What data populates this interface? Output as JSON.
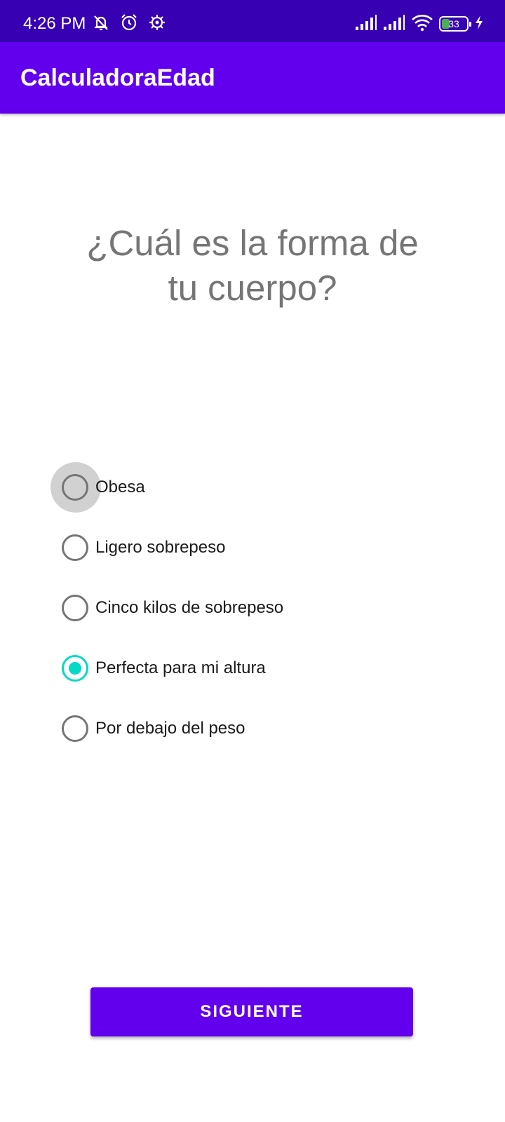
{
  "status_bar": {
    "time": "4:26 PM",
    "left_icons": [
      "muted-bell-icon",
      "alarm-icon",
      "settings-gear-icon"
    ],
    "right_icons": [
      "signal-bars-icon",
      "signal-bars-icon",
      "wifi-icon",
      "battery-icon",
      "charging-bolt-icon"
    ],
    "battery_level": "33",
    "battery_fill_color": "#4caf50"
  },
  "app_bar": {
    "title": "CalculadoraEdad",
    "color": "#6200ee"
  },
  "question": {
    "line1": "¿Cuál es la forma de",
    "line2": "tu cuerpo?"
  },
  "options": [
    {
      "label": "Obesa",
      "checked": false,
      "pressed": true
    },
    {
      "label": "Ligero sobrepeso",
      "checked": false,
      "pressed": false
    },
    {
      "label": "Cinco kilos de sobrepeso",
      "checked": false,
      "pressed": false
    },
    {
      "label": "Perfecta para mi altura",
      "checked": true,
      "pressed": false
    },
    {
      "label": "Por debajo del peso",
      "checked": false,
      "pressed": false
    }
  ],
  "accent_color": "#03dac5",
  "next_button": {
    "label": "SIGUIENTE"
  }
}
